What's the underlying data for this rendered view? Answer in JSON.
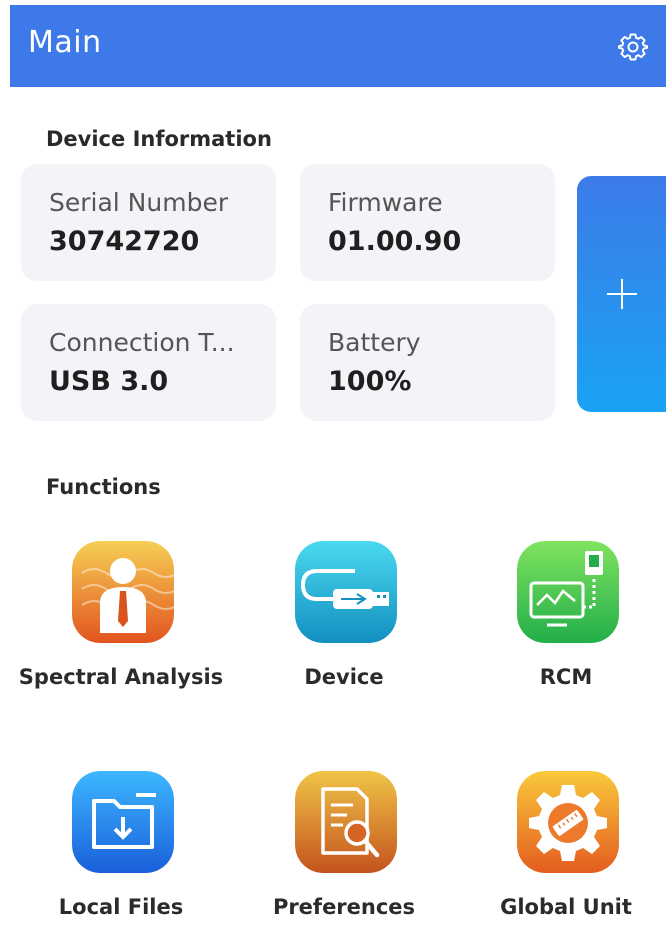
{
  "header": {
    "title": "Main",
    "settings_icon": "gear-icon",
    "background_color": "#3d79e8"
  },
  "device_info": {
    "section_title": "Device Information",
    "cards": [
      {
        "label": "Serial Number",
        "value": "30742720"
      },
      {
        "label": "Firmware",
        "value": "01.00.90"
      },
      {
        "label": "Connection T...",
        "value": "USB 3.0"
      },
      {
        "label": "Battery",
        "value": "100%"
      }
    ],
    "add_icon": "plus-icon"
  },
  "functions": {
    "section_title": "Functions",
    "items": [
      {
        "label": "Spectral Analysis",
        "icon": "spectral-analysis-icon",
        "colors": [
          "#f4c64a",
          "#e35a22"
        ]
      },
      {
        "label": "Device",
        "icon": "usb-device-icon",
        "colors": [
          "#47d7ef",
          "#138fc0"
        ]
      },
      {
        "label": "RCM",
        "icon": "monitor-icon",
        "colors": [
          "#78e05d",
          "#24b24d"
        ]
      },
      {
        "label": "Local Files",
        "icon": "folder-download-icon",
        "colors": [
          "#38b1ff",
          "#1b62dc"
        ]
      },
      {
        "label": "Preferences",
        "icon": "document-search-icon",
        "colors": [
          "#f1c145",
          "#c8571f"
        ]
      },
      {
        "label": "Global Unit",
        "icon": "gear-ruler-icon",
        "colors": [
          "#f7c53c",
          "#e76020"
        ]
      }
    ]
  }
}
